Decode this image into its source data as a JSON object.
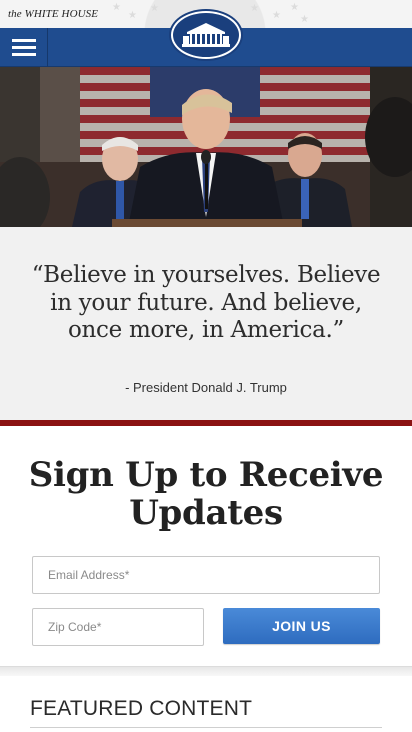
{
  "header": {
    "brand": "the WHITE HOUSE"
  },
  "nav": {
    "menu_icon": "hamburger-menu-icon",
    "seal_icon": "white-house-seal-icon",
    "bar_color": "#1f4c8f"
  },
  "hero": {
    "image": "hero-photo"
  },
  "quote": {
    "text": "“Believe in yourselves. Believe in your future. And believe, once more, in America.”",
    "attribution": "- President Donald J. Trump",
    "rule_color": "#8b1212"
  },
  "signup": {
    "title": "Sign Up to Receive Updates",
    "email_placeholder": "Email Address*",
    "zip_placeholder": "Zip Code*",
    "button_label": "JOIN US",
    "button_color": "#3a7bcf"
  },
  "featured": {
    "heading": "FEATURED CONTENT"
  }
}
